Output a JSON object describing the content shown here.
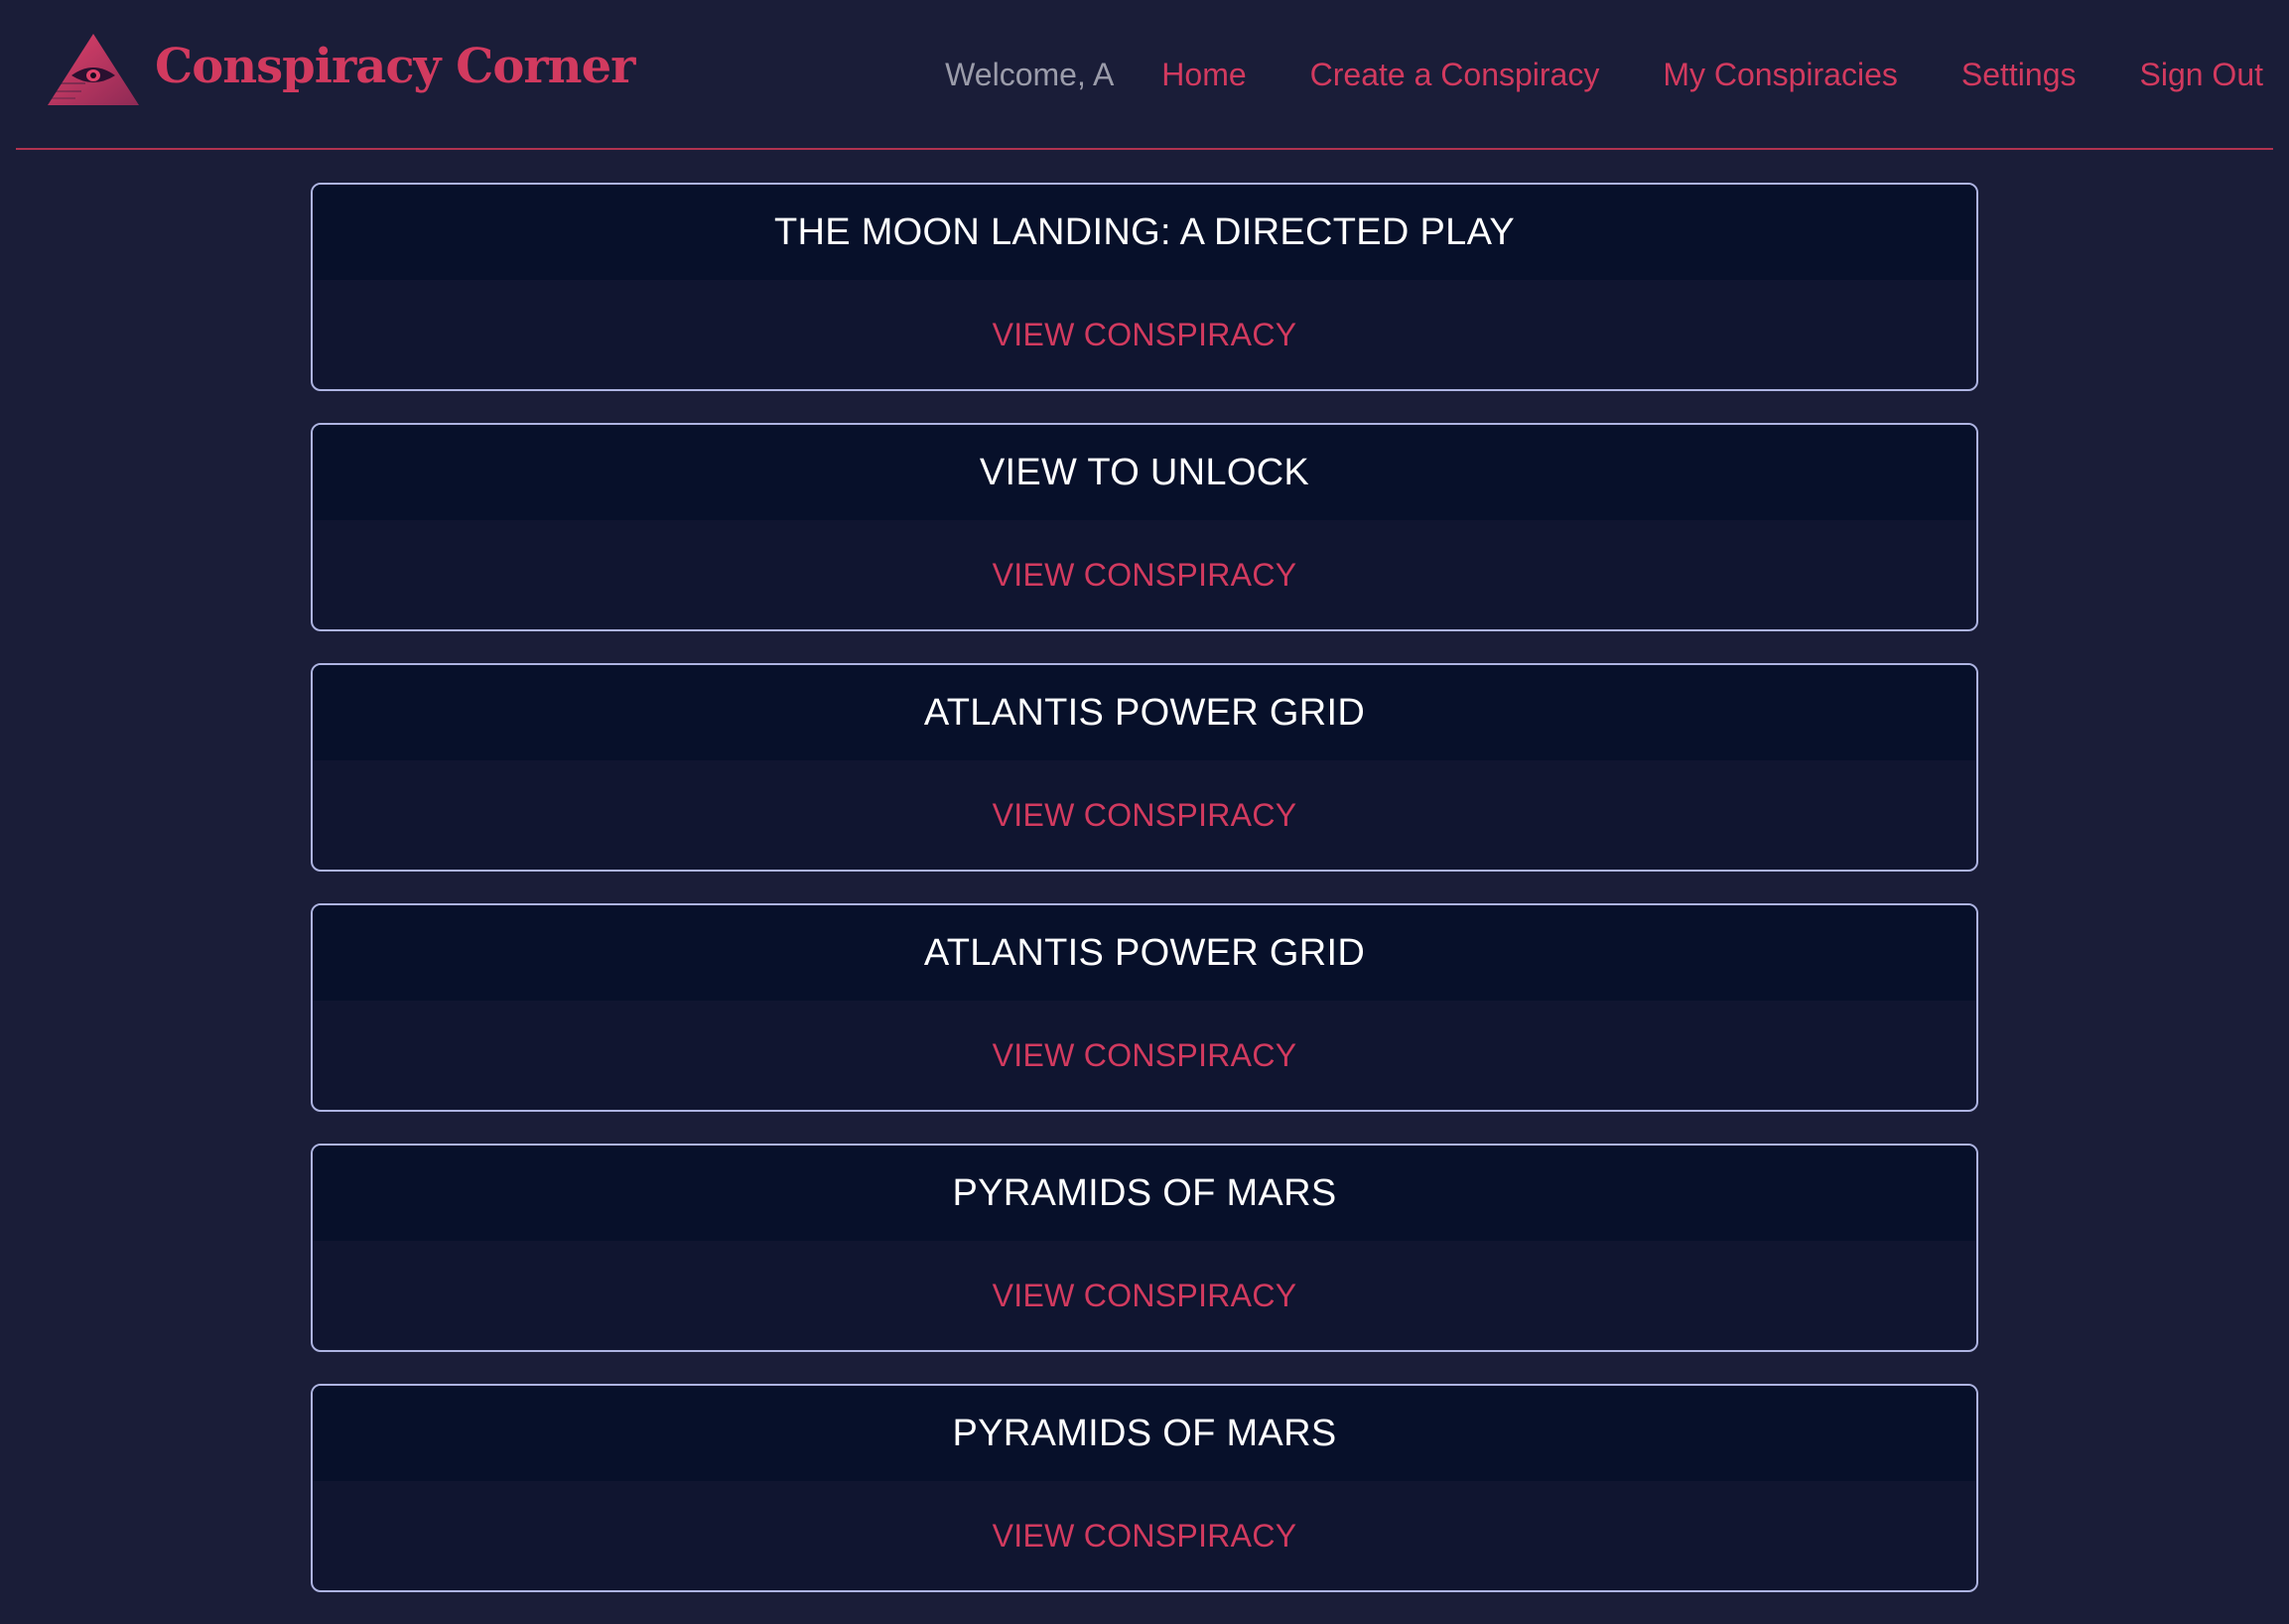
{
  "header": {
    "brand": "Conspiracy Corner",
    "welcome": "Welcome, A",
    "nav": [
      "Home",
      "Create a Conspiracy",
      "My Conspiracies",
      "Settings",
      "Sign Out"
    ]
  },
  "colors": {
    "background": "#1a1d38",
    "accent": "#d23a5f",
    "card_header": "#07102a",
    "card_body": "#101530",
    "card_border": "#aeb4e2"
  },
  "icons": {
    "logo": "all-seeing-eye-pyramid-icon"
  },
  "conspiracies": [
    {
      "title": "THE MOON LANDING: A DIRECTED PLAY",
      "link": "VIEW CONSPIRACY"
    },
    {
      "title": "VIEW TO UNLOCK",
      "link": "VIEW CONSPIRACY"
    },
    {
      "title": "ATLANTIS POWER GRID",
      "link": "VIEW CONSPIRACY"
    },
    {
      "title": "ATLANTIS POWER GRID",
      "link": "VIEW CONSPIRACY"
    },
    {
      "title": "PYRAMIDS OF MARS",
      "link": "VIEW CONSPIRACY"
    },
    {
      "title": "PYRAMIDS OF MARS",
      "link": "VIEW CONSPIRACY"
    }
  ]
}
